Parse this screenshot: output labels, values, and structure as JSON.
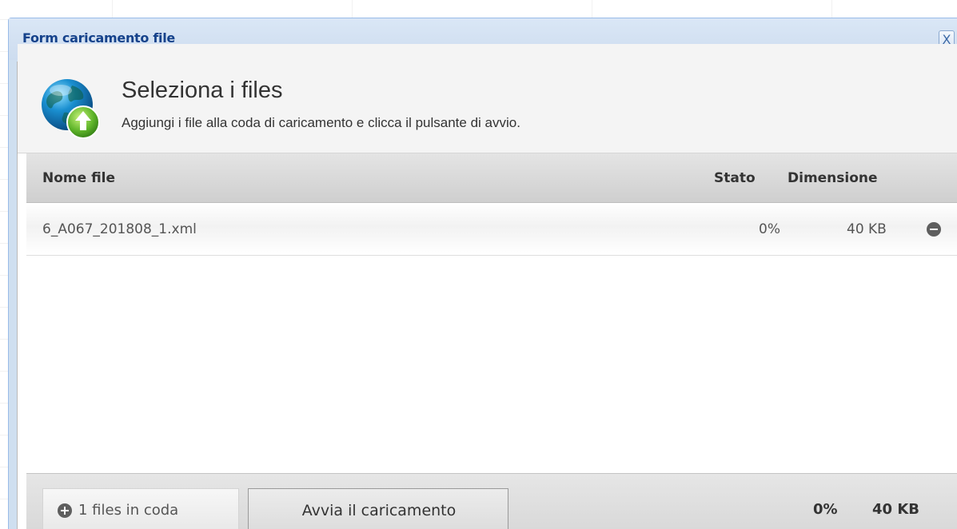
{
  "dialog": {
    "title": "Form caricamento file",
    "close_label": "X"
  },
  "upload_header": {
    "title": "Seleziona i files",
    "subtitle": "Aggiungi i file alla coda di caricamento e clicca il pulsante di avvio.",
    "icon": "globe-upload-icon"
  },
  "columns": {
    "name": "Nome file",
    "status": "Stato",
    "size": "Dimensione"
  },
  "files": [
    {
      "name": "6_A067_201808_1.xml",
      "status": "0%",
      "size": "40 KB",
      "remove_icon": "remove-icon"
    }
  ],
  "footer": {
    "add_files_label": "1 files in coda",
    "add_icon": "plus-circle-icon",
    "start_label": "Avvia il caricamento",
    "total_percent": "0%",
    "total_size": "40 KB"
  },
  "colors": {
    "title_blue": "#15428b",
    "header_bg": "#cfdff0",
    "icon_gray": "#5e5e5e"
  }
}
